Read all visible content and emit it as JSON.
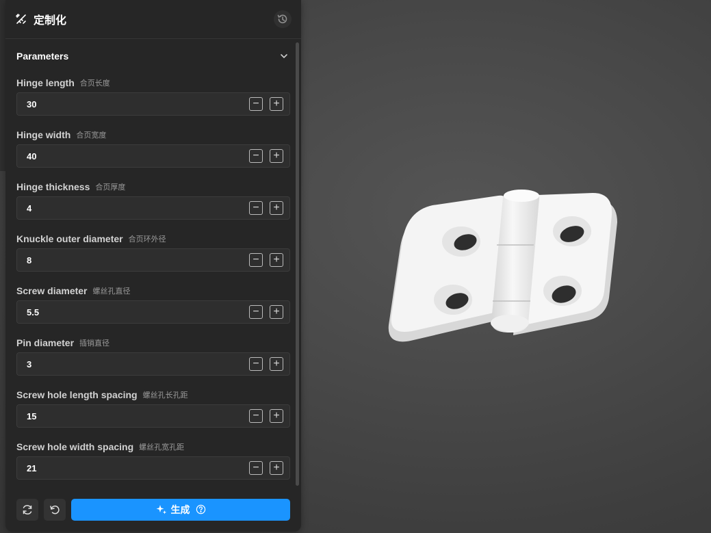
{
  "panel": {
    "title": "定制化",
    "title_icon": "wand-ruler-icon",
    "history_icon": "history-icon"
  },
  "section": {
    "label": "Parameters",
    "expanded": true
  },
  "params": [
    {
      "label": "Hinge length",
      "label_zh": "合页长度",
      "value": "30"
    },
    {
      "label": "Hinge width",
      "label_zh": "合页宽度",
      "value": "40"
    },
    {
      "label": "Hinge thickness",
      "label_zh": "合页厚度",
      "value": "4"
    },
    {
      "label": "Knuckle outer diameter",
      "label_zh": "合页环外径",
      "value": "8"
    },
    {
      "label": "Screw diameter",
      "label_zh": "螺丝孔直径",
      "value": "5.5"
    },
    {
      "label": "Pin diameter",
      "label_zh": "插销直径",
      "value": "3"
    },
    {
      "label": "Screw hole length spacing",
      "label_zh": "螺丝孔长孔距",
      "value": "15"
    },
    {
      "label": "Screw hole width spacing",
      "label_zh": "螺丝孔宽孔距",
      "value": "21"
    }
  ],
  "stepper": {
    "minus": "−",
    "plus": "+"
  },
  "footer": {
    "refresh_icon": "refresh-icon",
    "reset_icon": "undo-icon",
    "generate_label": "生成",
    "generate_icon": "sparkle-icon",
    "help_icon": "help-circle-icon"
  },
  "colors": {
    "accent": "#1a94ff",
    "panel_bg": "#262626",
    "field_bg": "#2e2e2e",
    "viewport_bg": "#484848",
    "model": "#f2f2f2"
  }
}
